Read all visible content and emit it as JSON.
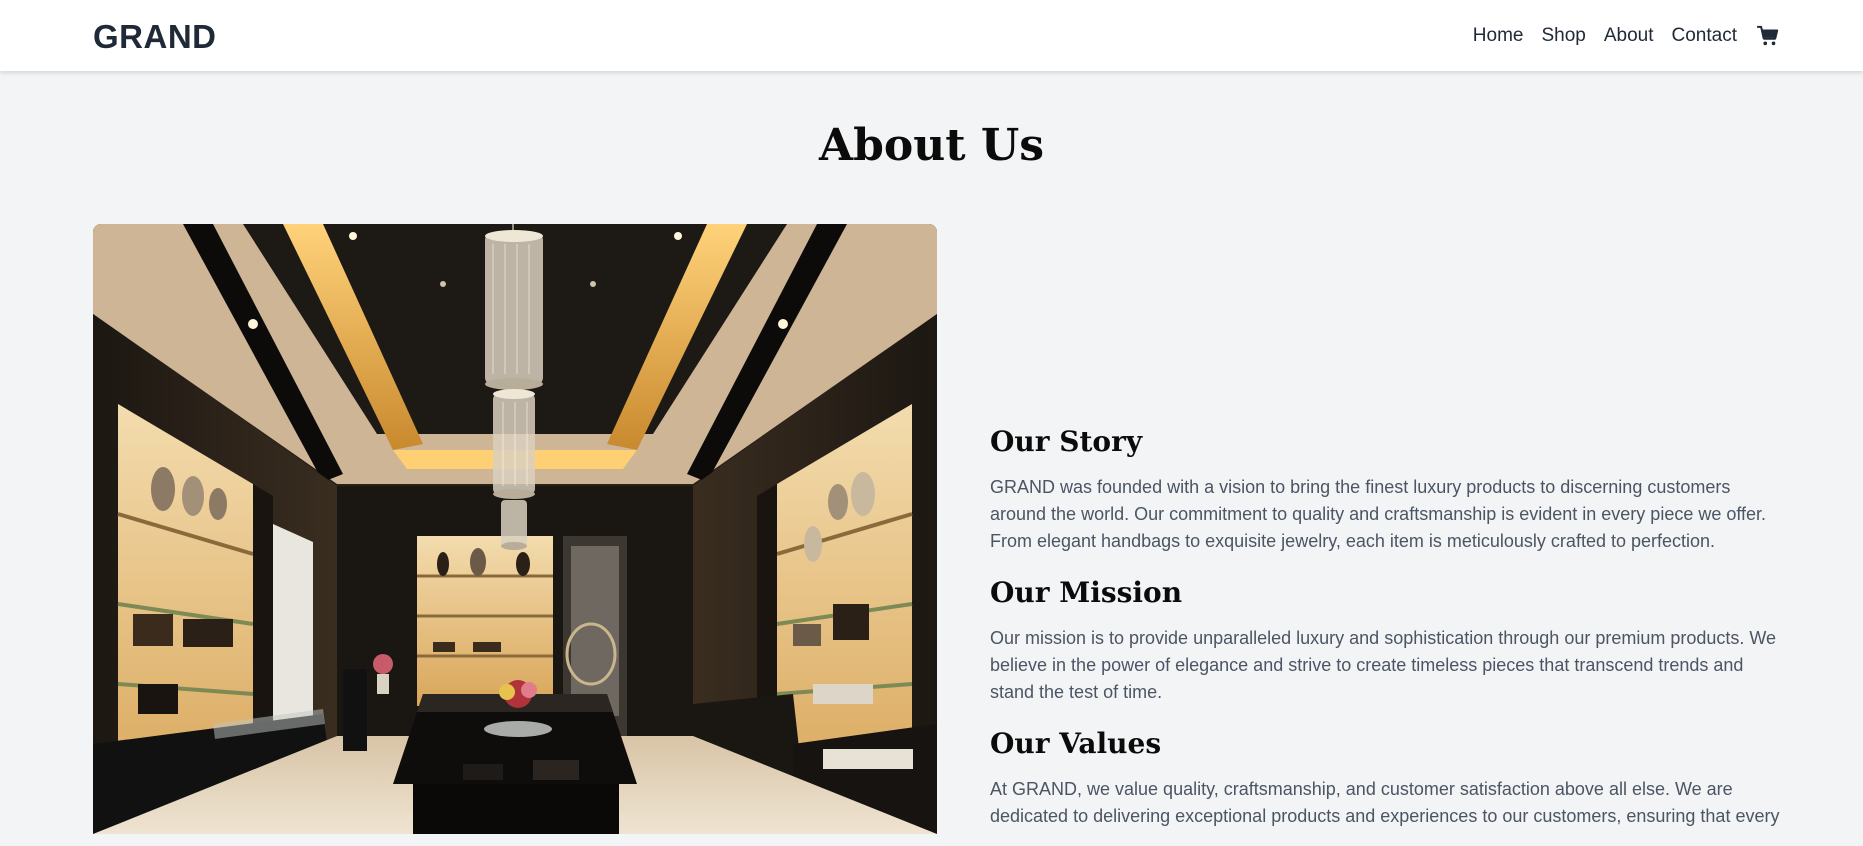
{
  "nav": {
    "brand": "GRAND",
    "links": [
      "Home",
      "Shop",
      "About",
      "Contact"
    ],
    "cart_icon": "shopping-cart-icon"
  },
  "page": {
    "title": "About Us"
  },
  "sections": [
    {
      "heading": "Our Story",
      "text": "GRAND was founded with a vision to bring the finest luxury products to discerning customers around the world. Our commitment to quality and craftsmanship is evident in every piece we offer. From elegant handbags to exquisite jewelry, each item is meticulously crafted to perfection."
    },
    {
      "heading": "Our Mission",
      "text": "Our mission is to provide unparalleled luxury and sophistication through our premium products. We believe in the power of elegance and strive to create timeless pieces that transcend trends and stand the test of time."
    },
    {
      "heading": "Our Values",
      "text": "At GRAND, we value quality, craftsmanship, and customer satisfaction above all else. We are dedicated to delivering exceptional products and experiences to our customers, ensuring that every"
    }
  ],
  "colors": {
    "background": "#f3f4f6",
    "nav_background": "#ffffff",
    "heading": "#0b0b0b",
    "body_text": "#4b5563",
    "brand_text": "#1f2937"
  }
}
